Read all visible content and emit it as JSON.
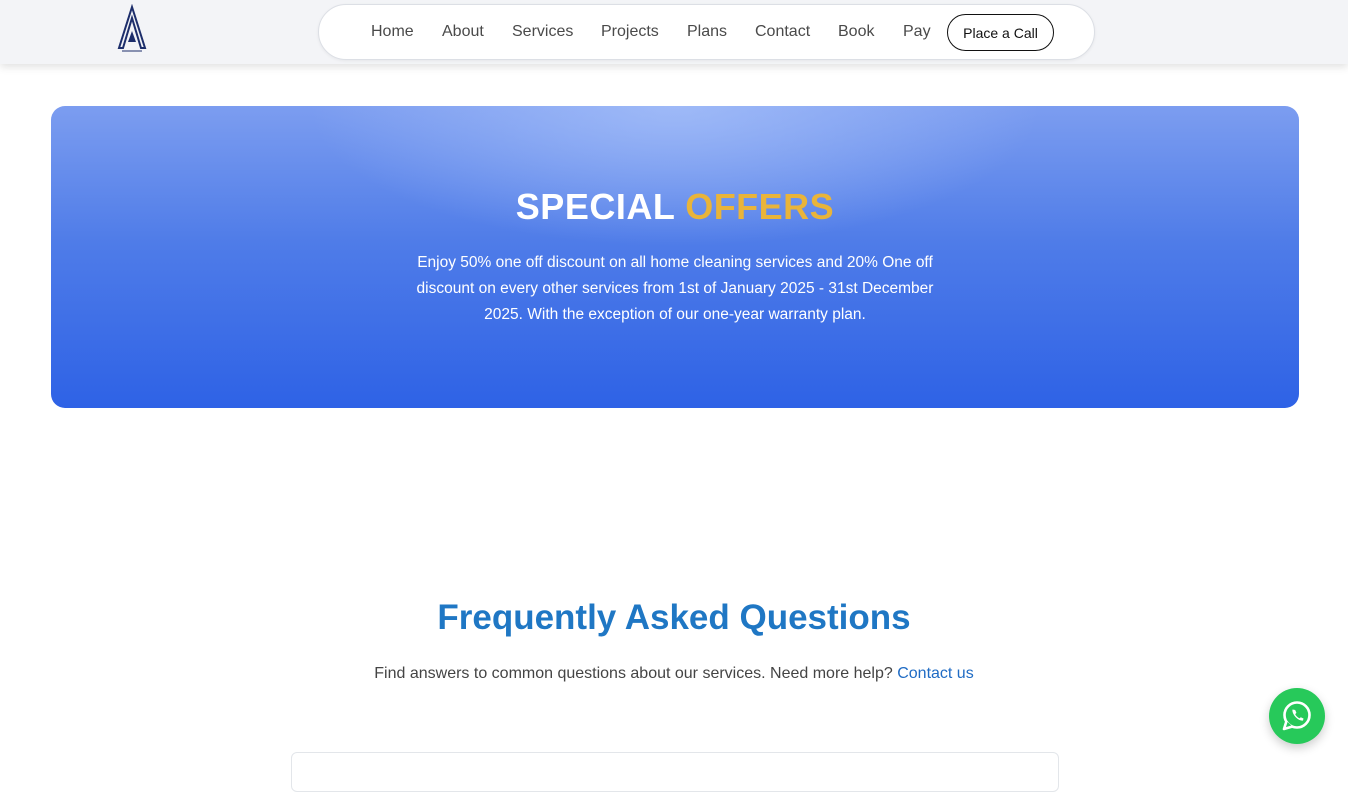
{
  "header": {
    "logo_icon": "company-logo-icon",
    "nav": [
      {
        "label": "Home"
      },
      {
        "label": "About"
      },
      {
        "label": "Services"
      },
      {
        "label": "Projects"
      },
      {
        "label": "Plans"
      },
      {
        "label": "Contact"
      },
      {
        "label": "Book"
      },
      {
        "label": "Pay"
      }
    ],
    "call_button": "Place a Call"
  },
  "offer": {
    "title_main": "SPECIAL",
    "title_accent": "OFFERS",
    "description": "Enjoy 50% one off discount on all home cleaning services and 20% One off discount on every other services from 1st of January 2025 - 31st December 2025. With the exception of our one-year warranty plan.",
    "accent_color": "#e9b43a"
  },
  "faq": {
    "title": "Frequently Asked Questions",
    "subtitle": "Find answers to common questions about our services. Need more help?",
    "contact_link": "Contact us"
  },
  "floating": {
    "whatsapp_icon": "whatsapp-icon",
    "color": "#27c95a"
  }
}
